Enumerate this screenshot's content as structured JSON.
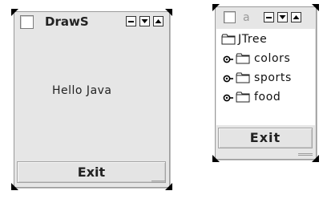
{
  "window1": {
    "title": "DrawS",
    "content_text": "Hello Java",
    "exit_label": "Exit"
  },
  "window2": {
    "title": "a",
    "tree": {
      "root": "JTree",
      "children": [
        {
          "label": "colors"
        },
        {
          "label": "sports"
        },
        {
          "label": "food"
        }
      ]
    },
    "exit_label": "Exit"
  },
  "icons": {
    "close": "close-box-icon",
    "minimize": "minimize-icon",
    "collapse": "triangle-down-icon",
    "expand_window": "triangle-up-icon",
    "folder": "folder-icon",
    "tree_expand": "expand-handle-icon",
    "resize": "resize-grip-icon"
  }
}
